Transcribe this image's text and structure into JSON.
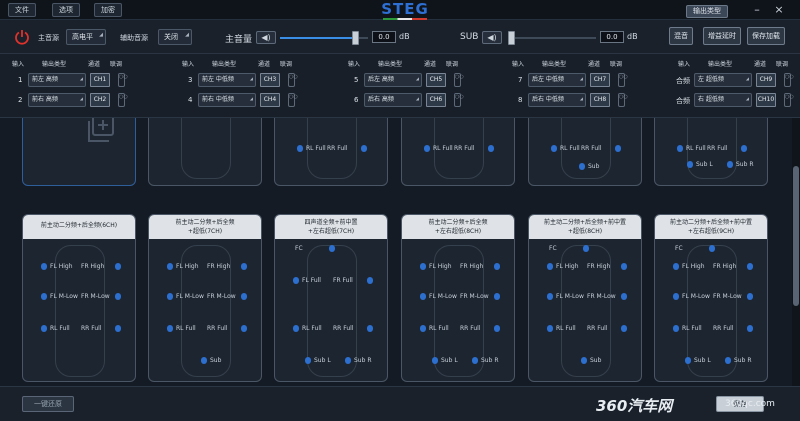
{
  "menu": {
    "file": "文件",
    "options": "选项",
    "encrypt": "加密"
  },
  "brand": "STEG",
  "top_right": {
    "output_type": "输出类型",
    "minimize": "–",
    "close": "×"
  },
  "toolbar": {
    "main_source_label": "主音源",
    "main_source_value": "高电平",
    "aux_source_label": "辅助音源",
    "aux_source_value": "关闭",
    "main_volume_label": "主音量",
    "main_volume_value": "0.0",
    "main_volume_unit": "dB",
    "main_volume_level": 0.85,
    "sub_label": "SUB",
    "sub_value": "0.0",
    "sub_unit": "dB",
    "sub_level": 0.0,
    "mix_button": "混音",
    "delay_button": "增益延时",
    "save_load_button": "保存加载"
  },
  "routing": {
    "header": {
      "input": "输入",
      "output_type": "输出类型",
      "channel": "通道",
      "link": "联调"
    },
    "rows": [
      {
        "input": "1",
        "output": "前左 高频",
        "channel": "CH1"
      },
      {
        "input": "2",
        "output": "前右 高频",
        "channel": "CH2"
      },
      {
        "input": "3",
        "output": "前左 中低频",
        "channel": "CH3"
      },
      {
        "input": "4",
        "output": "前右 中低频",
        "channel": "CH4"
      },
      {
        "input": "5",
        "output": "后左 高频",
        "channel": "CH5"
      },
      {
        "input": "6",
        "output": "后右 高频",
        "channel": "CH6"
      },
      {
        "input": "7",
        "output": "后左 中低频",
        "channel": "CH7"
      },
      {
        "input": "8",
        "output": "后右 中低频",
        "channel": "CH8"
      },
      {
        "input": "合频",
        "output": "左 超低频",
        "channel": "CH9"
      },
      {
        "input": "合频",
        "output": "右 超低频",
        "channel": "CH10"
      }
    ]
  },
  "presets_top_row": [
    {
      "labels": []
    },
    {
      "labels": []
    },
    {
      "labels": [
        "RL Full",
        "RR Full"
      ]
    },
    {
      "labels": [
        "RL Full",
        "RR Full"
      ]
    },
    {
      "labels": [
        "RL Full",
        "RR Full",
        "Sub"
      ]
    },
    {
      "labels": [
        "RL Full",
        "RR Full",
        "Sub L",
        "Sub R"
      ]
    }
  ],
  "presets": [
    {
      "title_l1": "前主动二分频+后全频(6CH)",
      "title_l2": "",
      "labels": {
        "fl_high": "FL High",
        "fr_high": "FR High",
        "fl_mlow": "FL M-Low",
        "fr_mlow": "FR M-Low",
        "rl_full": "RL Full",
        "rr_full": "RR Full"
      }
    },
    {
      "title_l1": "前主动二分频+后全频",
      "title_l2": "+超低(7CH)",
      "labels": {
        "fl_high": "FL High",
        "fr_high": "FR High",
        "fl_mlow": "FL M-Low",
        "fr_mlow": "FR M-Low",
        "rl_full": "RL Full",
        "rr_full": "RR Full",
        "sub": "Sub"
      }
    },
    {
      "title_l1": "四声道全频+前中置",
      "title_l2": "+左右超低(7CH)",
      "labels": {
        "fc": "FC",
        "fl_full": "FL Full",
        "fr_full": "FR Full",
        "rl_full": "RL Full",
        "rr_full": "RR Full",
        "sub_l": "Sub L",
        "sub_r": "Sub R"
      }
    },
    {
      "title_l1": "前主动二分频+后全频",
      "title_l2": "+左右超低(8CH)",
      "labels": {
        "fl_high": "FL High",
        "fr_high": "FR High",
        "fl_mlow": "FL M-Low",
        "fr_mlow": "FR M-Low",
        "rl_full": "RL Full",
        "rr_full": "RR Full",
        "sub_l": "Sub L",
        "sub_r": "Sub R"
      }
    },
    {
      "title_l1": "前主动二分频+后全频+前中置",
      "title_l2": "+超低(8CH)",
      "labels": {
        "fc": "FC",
        "fl_high": "FL High",
        "fr_high": "FR High",
        "fl_mlow": "FL M-Low",
        "fr_mlow": "FR M-Low",
        "rl_full": "RL Full",
        "rr_full": "RR Full",
        "sub": "Sub"
      }
    },
    {
      "title_l1": "前主动二分频+后全频+前中置",
      "title_l2": "+左右超低(9CH)",
      "labels": {
        "fc": "FC",
        "fl_high": "FL High",
        "fr_high": "FR High",
        "fl_mlow": "FL M-Low",
        "fr_mlow": "FR M-Low",
        "rl_full": "RL Full",
        "rr_full": "RR Full",
        "sub_l": "Sub L",
        "sub_r": "Sub R"
      }
    }
  ],
  "bottom": {
    "reset_button": "一键还原",
    "save_button": "保存",
    "watermark": "360汽车网",
    "watermark_url": "360qc.com"
  },
  "colors": {
    "accent": "#2e6fd4",
    "power": "#e0322b",
    "background": "#161c25"
  },
  "icons": {
    "power": "power-icon",
    "add": "add-preset-icon",
    "speaker": "speaker-icon",
    "link": "link-icon"
  }
}
